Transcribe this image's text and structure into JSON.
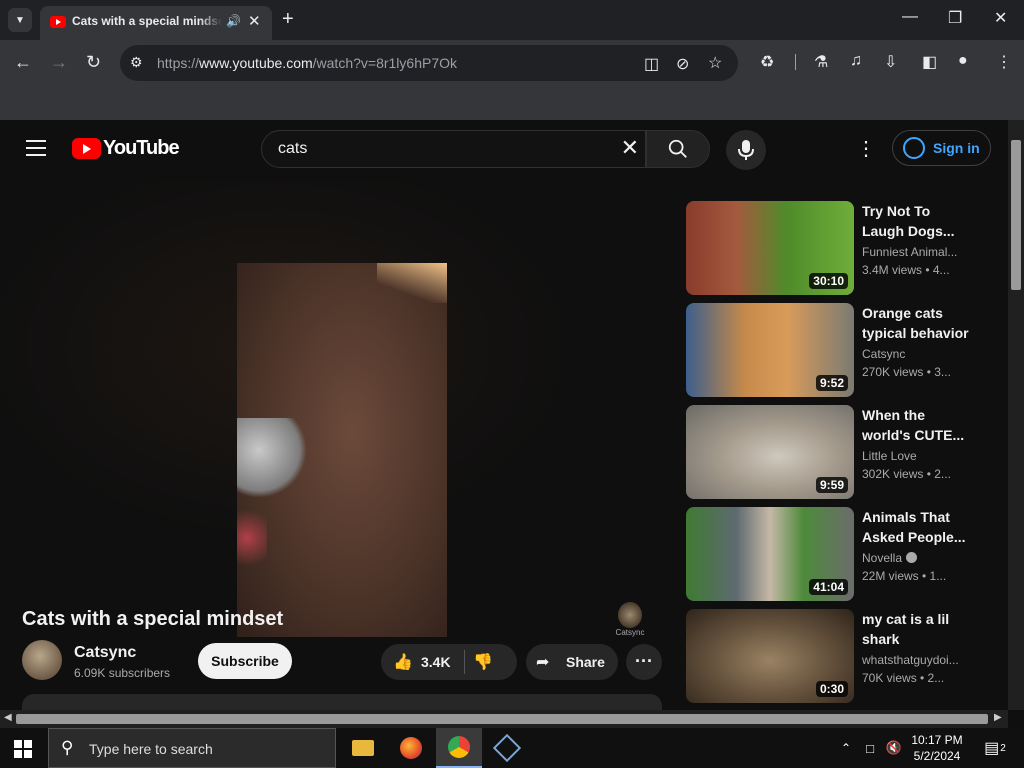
{
  "browser": {
    "tab_title": "Cats with a special mindset - YouTube",
    "url_prefix": "https://",
    "url_host": "www.youtube.com",
    "url_path": "/watch?v=8r1ly6hP7Ok"
  },
  "youtube": {
    "logo_text": "YouTube",
    "search_query": "cats",
    "sign_in_label": "Sign in",
    "video": {
      "watermark": "Catsync",
      "title": "Cats with a special mindset",
      "channel_name": "Catsync",
      "subscribers": "6.09K subscribers",
      "subscribe_label": "Subscribe",
      "like_count": "3.4K",
      "share_label": "Share"
    },
    "recommendations": [
      {
        "title": "Try Not To\nLaugh Dogs...",
        "channel": "Funniest Animal...",
        "meta": "3.4M views  • 4...",
        "duration": "30:10"
      },
      {
        "title": "Orange cats\ntypical behavior",
        "channel": "Catsync",
        "meta": "270K views  • 3...",
        "duration": "9:52"
      },
      {
        "title": "When the\nworld's CUTE...",
        "channel": "Little Love",
        "meta": "302K views  • 2...",
        "duration": "9:59"
      },
      {
        "title": "Animals That\nAsked People...",
        "channel": "Novella",
        "meta": "22M views  • 1...",
        "duration": "41:04"
      },
      {
        "title": "my cat is a lil\nshark",
        "channel": "whatsthatguydoi...",
        "meta": "70K views  • 2...",
        "duration": "0:30"
      }
    ]
  },
  "taskbar": {
    "search_placeholder": "Type here to search",
    "time": "10:17 PM",
    "date": "5/2/2024",
    "notification_count": "2"
  }
}
